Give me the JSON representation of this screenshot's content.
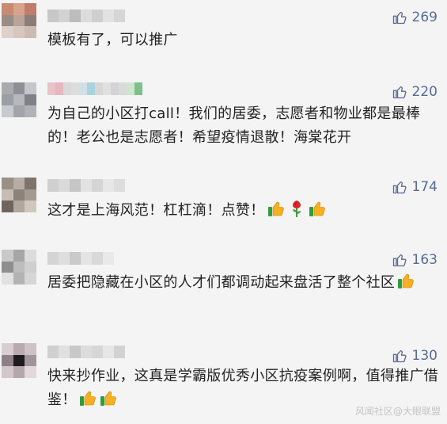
{
  "comments": [
    {
      "likes": "269",
      "text": "模板有了，可以推广",
      "emojis": [],
      "avatar_colors": [
        "#c98a74",
        "#d9a28c",
        "#c07d6b",
        "#9a8c86",
        "#b9a49b",
        "#8d7d78",
        "#e0d0c8",
        "#d5c7c0",
        "#ccbbb2"
      ],
      "name_colors": [
        "#c8c8c8",
        "#d2d2d2",
        "#bdbdbd",
        "#dcdcdc",
        "#cfcfcf",
        "#e2e2e2",
        "#d6d6d6"
      ]
    },
    {
      "likes": "220",
      "text": "为自己的小区打call！我们的居委，志愿者和物业都是最棒的！老公也是志愿者！希望疫情退散！海棠花开",
      "emojis": [],
      "avatar_colors": [
        "#a8aab0",
        "#8e9096",
        "#c5c6ca",
        "#9c9ea5",
        "#b7b8bd",
        "#7f8187",
        "#c9cacf",
        "#a2a4aa",
        "#b0b2b7"
      ],
      "name_colors": [
        "#e8c3c8",
        "#e6b7bf",
        "#d9d9d9",
        "#dcdcdc",
        "#cfe0e6",
        "#a9d3de",
        "#d7d7d7",
        "#e0e0e0",
        "#d4d4d4",
        "#dadada",
        "#cfe5cf",
        "#7fbf8c"
      ]
    },
    {
      "likes": "174",
      "text": "这才是上海风范！杠杠滴！点赞！",
      "emojis": [
        "thumbs-up",
        "rose",
        "thumbs-up"
      ],
      "avatar_colors": [
        "#9a8f86",
        "#b8ada4",
        "#7f746c",
        "#c6bcb3",
        "#8d827a",
        "#a59a91",
        "#6f655e",
        "#b2a79e",
        "#d0c7bf"
      ],
      "name_colors": [
        "#d0d0d0",
        "#dadada",
        "#c6c6c6",
        "#e2e2e2",
        "#d5d5d5",
        "#e7e7e7",
        "#dddddd"
      ]
    },
    {
      "likes": "163",
      "text": "居委把隐藏在小区的人才们都调动起来盘活了整个社区",
      "emojis": [
        "thumbs-up"
      ],
      "avatar_colors": [
        "#c9c9c9",
        "#a6a6a6",
        "#dcdcdc",
        "#8f8f8f",
        "#bdbdbd",
        "#cfcfcf",
        "#e1e1e1",
        "#b3b3b3",
        "#d6d6d6"
      ],
      "name_colors": [
        "#d4d4d4",
        "#dedede",
        "#cacaca",
        "#e4e4e4",
        "#d8d8d8",
        "#e9e9e9"
      ]
    },
    {
      "likes": "130",
      "text": "快来抄作业，这真是学霸版优秀小区抗疫案例啊，值得推广借鉴！",
      "emojis": [
        "thumbs-up",
        "thumbs-up"
      ],
      "avatar_colors": [
        "#d9cfd3",
        "#b9a9b0",
        "#cfc2c7",
        "#8f7f86",
        "#1f1a1c",
        "#a3939a",
        "#d3c7cc",
        "#b5a6ad",
        "#e2d8dc"
      ],
      "name_colors": [
        "#d0d0d0",
        "#e0e0e0",
        "#c8c8c8",
        "#dcdcdc",
        "#d6d6d6",
        "#e6e6e6",
        "#d2d2d2"
      ]
    }
  ],
  "watermark": "风闻社区@大眼联盟",
  "colors": {
    "like": "#576b95",
    "text": "#222222",
    "background": "#f4f4f4"
  },
  "icons": {
    "like": "thumbs-up-outline-icon"
  }
}
